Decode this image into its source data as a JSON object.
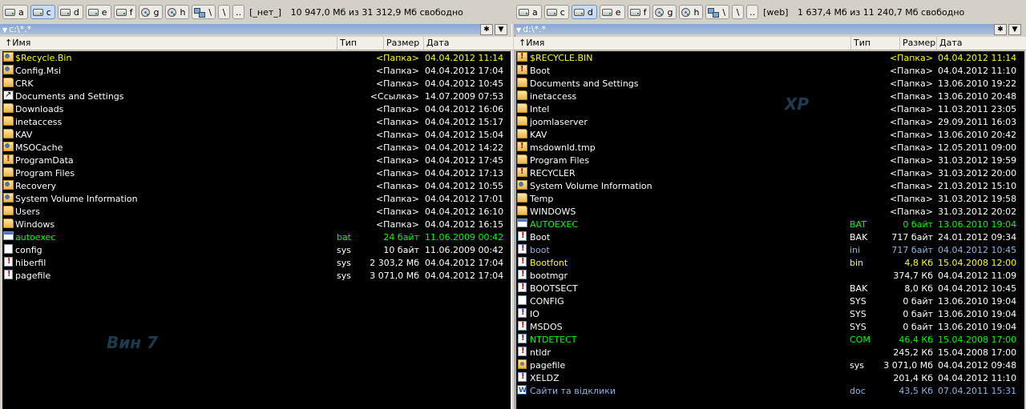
{
  "left": {
    "drives": [
      {
        "letter": "a",
        "type": "floppy",
        "active": false
      },
      {
        "letter": "c",
        "type": "hdd",
        "active": true
      },
      {
        "letter": "d",
        "type": "hdd",
        "active": false
      },
      {
        "letter": "e",
        "type": "hdd",
        "active": false
      },
      {
        "letter": "f",
        "type": "hdd",
        "active": false
      },
      {
        "letter": "g",
        "type": "cd",
        "active": false
      },
      {
        "letter": "h",
        "type": "cd",
        "active": false
      },
      {
        "letter": "\\",
        "type": "network",
        "active": false
      }
    ],
    "root_button": "\\",
    "up_button": "..",
    "volume_label": "[_нет_]",
    "free_space": "10 947,0 Мб из 31 312,9 Мб свободно",
    "path": "c:\\*.*",
    "star_button": "✱",
    "dropdown_button": "▼",
    "columns": {
      "name": "Имя",
      "type": "Тип",
      "size": "Размер",
      "date": "Дата"
    },
    "sort_indicator": "↑",
    "watermark": "Вин 7",
    "files": [
      {
        "name": "$Recycle.Bin",
        "ext": "",
        "size": "<Папка>",
        "date": "04.04.2012 11:14",
        "color": "#ffff00",
        "icon": "fld-s"
      },
      {
        "name": "Config.Msi",
        "ext": "",
        "size": "<Папка>",
        "date": "04.04.2012 17:04",
        "color": "#ffffff",
        "icon": "fld-s"
      },
      {
        "name": "CRK",
        "ext": "",
        "size": "<Папка>",
        "date": "04.04.2012 10:45",
        "color": "#ffffff",
        "icon": "fld"
      },
      {
        "name": "Documents and Settings",
        "ext": "",
        "size": "<Ссылка>",
        "date": "14.07.2009 07:53",
        "color": "#ffffff",
        "icon": "lnk"
      },
      {
        "name": "Downloads",
        "ext": "",
        "size": "<Папка>",
        "date": "04.04.2012 16:06",
        "color": "#ffffff",
        "icon": "fld"
      },
      {
        "name": "inetaccess",
        "ext": "",
        "size": "<Папка>",
        "date": "04.04.2012 15:17",
        "color": "#ffffff",
        "icon": "fld"
      },
      {
        "name": "KAV",
        "ext": "",
        "size": "<Папка>",
        "date": "04.04.2012 15:04",
        "color": "#ffffff",
        "icon": "fld"
      },
      {
        "name": "MSOCache",
        "ext": "",
        "size": "<Папка>",
        "date": "04.04.2012 14:22",
        "color": "#ffffff",
        "icon": "fld-s"
      },
      {
        "name": "ProgramData",
        "ext": "",
        "size": "<Папка>",
        "date": "04.04.2012 17:45",
        "color": "#ffffff",
        "icon": "fld-h"
      },
      {
        "name": "Program Files",
        "ext": "",
        "size": "<Папка>",
        "date": "04.04.2012 17:13",
        "color": "#ffffff",
        "icon": "fld"
      },
      {
        "name": "Recovery",
        "ext": "",
        "size": "<Папка>",
        "date": "04.04.2012 10:55",
        "color": "#ffffff",
        "icon": "fld-s"
      },
      {
        "name": "System Volume Information",
        "ext": "",
        "size": "<Папка>",
        "date": "04.04.2012 17:01",
        "color": "#ffffff",
        "icon": "fld-s"
      },
      {
        "name": "Users",
        "ext": "",
        "size": "<Папка>",
        "date": "04.04.2012 16:10",
        "color": "#ffffff",
        "icon": "fld"
      },
      {
        "name": "Windows",
        "ext": "",
        "size": "<Папка>",
        "date": "04.04.2012 16:15",
        "color": "#ffffff",
        "icon": "fld"
      },
      {
        "name": "autoexec",
        "ext": "bat",
        "size": "24 байт",
        "date": "11.06.2009 00:42",
        "color": "#00ff00",
        "icon": "bat"
      },
      {
        "name": "config",
        "ext": "sys",
        "size": "10 байт",
        "date": "11.06.2009 00:42",
        "color": "#ffffff",
        "icon": "fil"
      },
      {
        "name": "hiberfil",
        "ext": "sys",
        "size": "2 303,2 Мб",
        "date": "04.04.2012 17:04",
        "color": "#ffffff",
        "icon": "sysf"
      },
      {
        "name": "pagefile",
        "ext": "sys",
        "size": "3 071,0 Мб",
        "date": "04.04.2012 17:04",
        "color": "#ffffff",
        "icon": "sysf"
      }
    ]
  },
  "right": {
    "drives": [
      {
        "letter": "a",
        "type": "floppy",
        "active": false
      },
      {
        "letter": "c",
        "type": "hdd",
        "active": false
      },
      {
        "letter": "d",
        "type": "hdd",
        "active": true
      },
      {
        "letter": "e",
        "type": "hdd",
        "active": false
      },
      {
        "letter": "f",
        "type": "hdd",
        "active": false
      },
      {
        "letter": "g",
        "type": "cd",
        "active": false
      },
      {
        "letter": "h",
        "type": "cd",
        "active": false
      },
      {
        "letter": "\\",
        "type": "network",
        "active": false
      }
    ],
    "root_button": "\\",
    "up_button": "..",
    "volume_label": "[web]",
    "free_space": "1 637,4 Мб из 11 240,7 Мб свободно",
    "path": "d:\\*.*",
    "star_button": "✱",
    "dropdown_button": "▼",
    "columns": {
      "name": "Имя",
      "type": "Тип",
      "size": "Размер",
      "date": "Дата"
    },
    "sort_indicator": "↑",
    "watermark": "XP",
    "files": [
      {
        "name": "$RECYCLE.BIN",
        "ext": "",
        "size": "<Папка>",
        "date": "04.04.2012 11:14",
        "color": "#ffff00",
        "icon": "fld-h"
      },
      {
        "name": "Boot",
        "ext": "",
        "size": "<Папка>",
        "date": "04.04.2012 11:10",
        "color": "#ffffff",
        "icon": "fld-h"
      },
      {
        "name": "Documents and Settings",
        "ext": "",
        "size": "<Папка>",
        "date": "13.06.2010 19:22",
        "color": "#ffffff",
        "icon": "fld"
      },
      {
        "name": "inetaccess",
        "ext": "",
        "size": "<Папка>",
        "date": "13.06.2010 20:48",
        "color": "#ffffff",
        "icon": "fld"
      },
      {
        "name": "Intel",
        "ext": "",
        "size": "<Папка>",
        "date": "11.03.2011 23:05",
        "color": "#ffffff",
        "icon": "fld"
      },
      {
        "name": "joomlaserver",
        "ext": "",
        "size": "<Папка>",
        "date": "29.09.2011 16:03",
        "color": "#ffffff",
        "icon": "fld"
      },
      {
        "name": "KAV",
        "ext": "",
        "size": "<Папка>",
        "date": "13.06.2010 20:42",
        "color": "#ffffff",
        "icon": "fld"
      },
      {
        "name": "msdownld.tmp",
        "ext": "",
        "size": "<Папка>",
        "date": "12.05.2011 09:00",
        "color": "#ffffff",
        "icon": "fld-h"
      },
      {
        "name": "Program Files",
        "ext": "",
        "size": "<Папка>",
        "date": "31.03.2012 19:59",
        "color": "#ffffff",
        "icon": "fld"
      },
      {
        "name": "RECYCLER",
        "ext": "",
        "size": "<Папка>",
        "date": "31.03.2012 20:00",
        "color": "#ffffff",
        "icon": "fld-h"
      },
      {
        "name": "System Volume Information",
        "ext": "",
        "size": "<Папка>",
        "date": "21.03.2012 15:10",
        "color": "#ffffff",
        "icon": "fld-s"
      },
      {
        "name": "Temp",
        "ext": "",
        "size": "<Папка>",
        "date": "31.03.2012 19:58",
        "color": "#ffffff",
        "icon": "fld"
      },
      {
        "name": "WINDOWS",
        "ext": "",
        "size": "<Папка>",
        "date": "31.03.2012 20:02",
        "color": "#ffffff",
        "icon": "fld"
      },
      {
        "name": "AUTOEXEC",
        "ext": "BAT",
        "size": "0 байт",
        "date": "13.06.2010 19:04",
        "color": "#00ff00",
        "icon": "bat"
      },
      {
        "name": "Boot",
        "ext": "BAK",
        "size": "717 байт",
        "date": "24.01.2012 09:34",
        "color": "#ffffff",
        "icon": "sysf"
      },
      {
        "name": "boot",
        "ext": "ini",
        "size": "717 байт",
        "date": "04.04.2012 10:45",
        "color": "#8fb4e3",
        "icon": "sysf"
      },
      {
        "name": "Bootfont",
        "ext": "bin",
        "size": "4,8 Кб",
        "date": "15.04.2008 12:00",
        "color": "#ffff00",
        "icon": "sysf"
      },
      {
        "name": "bootmgr",
        "ext": "",
        "size": "374,7 Кб",
        "date": "04.04.2012 11:09",
        "color": "#ffffff",
        "icon": "sysf"
      },
      {
        "name": "BOOTSECT",
        "ext": "BAK",
        "size": "8,0 Кб",
        "date": "04.04.2012 10:45",
        "color": "#ffffff",
        "icon": "sysf"
      },
      {
        "name": "CONFIG",
        "ext": "SYS",
        "size": "0 байт",
        "date": "13.06.2010 19:04",
        "color": "#ffffff",
        "icon": "fil"
      },
      {
        "name": "IO",
        "ext": "SYS",
        "size": "0 байт",
        "date": "13.06.2010 19:04",
        "color": "#ffffff",
        "icon": "sysf"
      },
      {
        "name": "MSDOS",
        "ext": "SYS",
        "size": "0 байт",
        "date": "13.06.2010 19:04",
        "color": "#ffffff",
        "icon": "sysf"
      },
      {
        "name": "NTDETECT",
        "ext": "COM",
        "size": "46,4 Кб",
        "date": "15.04.2008 17:00",
        "color": "#00ff00",
        "icon": "sysf"
      },
      {
        "name": "ntldr",
        "ext": "",
        "size": "245,2 Кб",
        "date": "15.04.2008 17:00",
        "color": "#ffffff",
        "icon": "sysf"
      },
      {
        "name": "pagefile",
        "ext": "sys",
        "size": "3 071,0 Мб",
        "date": "04.04.2012 09:48",
        "color": "#ffffff",
        "icon": "sysg"
      },
      {
        "name": "XELDZ",
        "ext": "",
        "size": "201,4 Кб",
        "date": "04.04.2012 11:10",
        "color": "#ffffff",
        "icon": "sysf"
      },
      {
        "name": "Сайти та відклики",
        "ext": "doc",
        "size": "43,5 Кб",
        "date": "07.04.2011 15:31",
        "color": "#8fb4e3",
        "icon": "doc"
      }
    ]
  }
}
